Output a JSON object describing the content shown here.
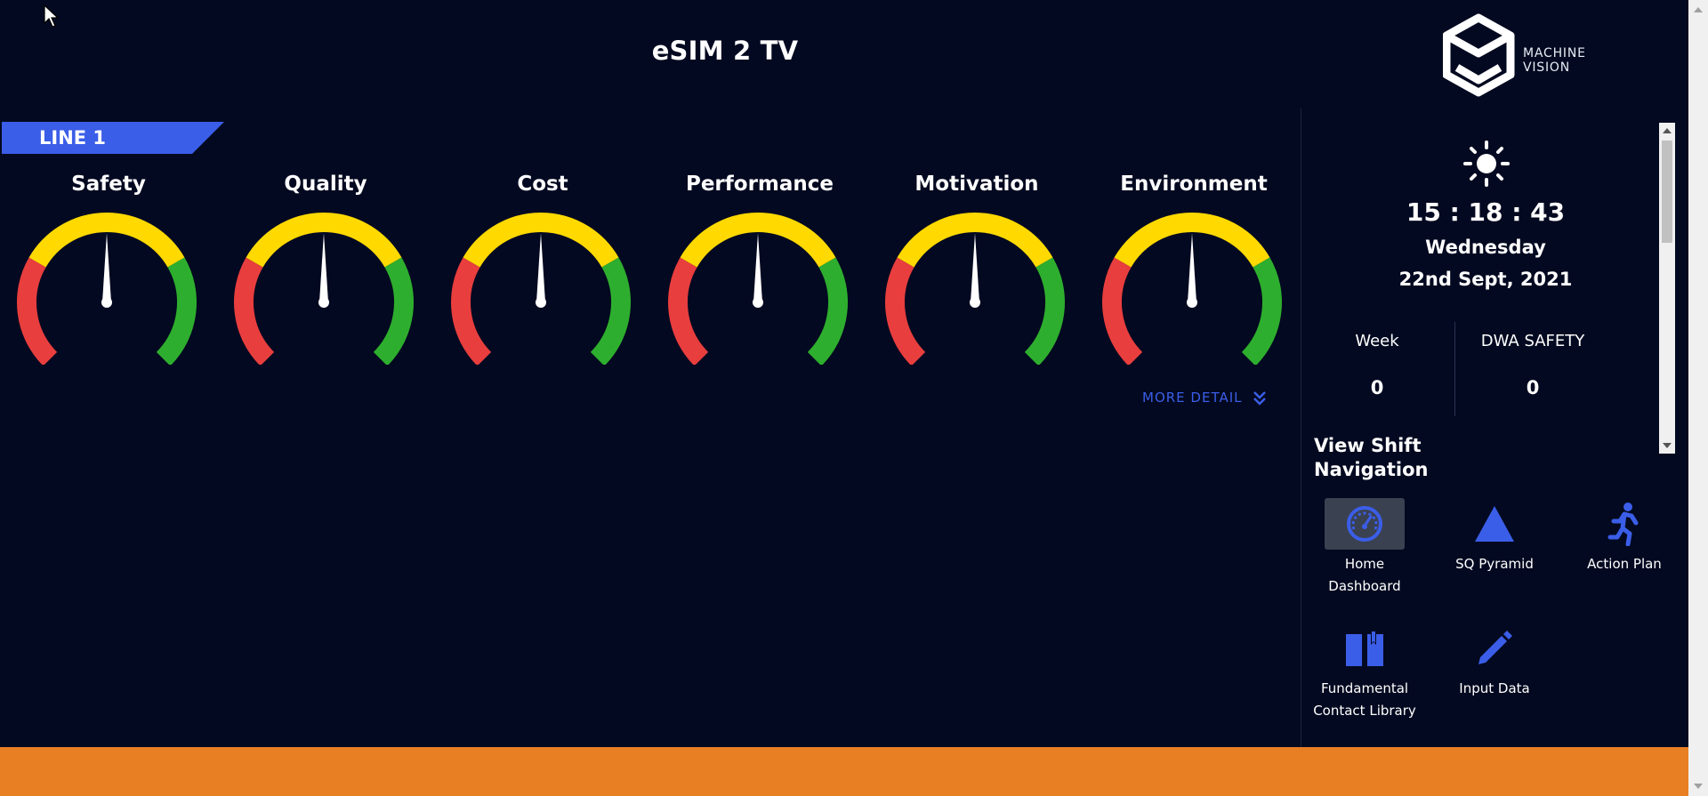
{
  "header": {
    "title": "eSIM 2 TV"
  },
  "logo": {
    "line1": "MACHINE",
    "line2": "VISION"
  },
  "line": {
    "label": "LINE 1"
  },
  "kpis": [
    {
      "title": "Safety",
      "level": 0.5
    },
    {
      "title": "Quality",
      "level": 0.5
    },
    {
      "title": "Cost",
      "level": 0.5
    },
    {
      "title": "Performance",
      "level": 0.5
    },
    {
      "title": "Motivation",
      "level": 0.5
    },
    {
      "title": "Environment",
      "level": 0.5
    }
  ],
  "gauge_colors": {
    "red": "#e83e3e",
    "yellow": "#ffd900",
    "green": "#2eae2e",
    "needle": "#ffffff"
  },
  "more_detail": {
    "label": "MORE DETAIL",
    "icon": "double-chevron-down-icon"
  },
  "info": {
    "weather_icon": "sun-icon",
    "time": "15 : 18 : 43",
    "day": "Wednesday",
    "date": "22nd Sept, 2021",
    "week_label": "Week",
    "week_value": "0",
    "dwa_label": "DWA SAFETY",
    "dwa_value": "0"
  },
  "navigation": {
    "heading_line1": "View Shift",
    "heading_line2": "Navigation",
    "items": [
      {
        "label_line1": "Home",
        "label_line2": "Dashboard",
        "icon": "speedometer-icon",
        "active": true
      },
      {
        "label_line1": "SQ Pyramid",
        "label_line2": "",
        "icon": "triangle-icon",
        "active": false
      },
      {
        "label_line1": "Action Plan",
        "label_line2": "",
        "icon": "running-person-icon",
        "active": false
      },
      {
        "label_line1": "Fundamental",
        "label_line2": "Contact Library",
        "icon": "book-icon",
        "active": false
      },
      {
        "label_line1": "Input Data",
        "label_line2": "",
        "icon": "pencil-icon",
        "active": false
      }
    ]
  },
  "colors": {
    "background": "#030920",
    "accent": "#3b5ee8",
    "footer": "#e87f22"
  }
}
